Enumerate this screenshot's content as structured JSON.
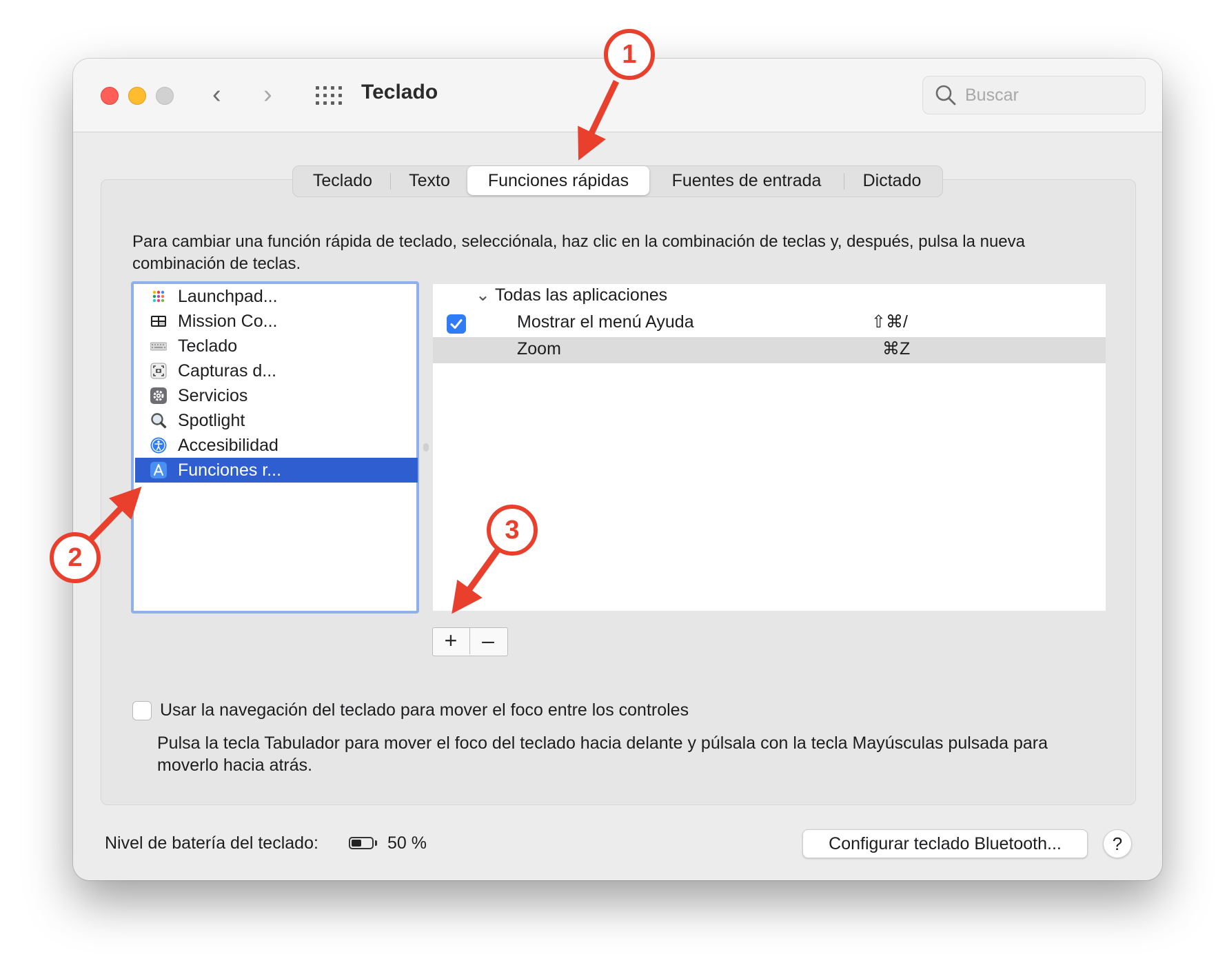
{
  "window": {
    "title": "Teclado"
  },
  "toolbar": {
    "back_glyph": "‹",
    "forward_glyph": "›",
    "search_placeholder": "Buscar"
  },
  "tabs": [
    {
      "label": "Teclado",
      "selected": false
    },
    {
      "label": "Texto",
      "selected": false
    },
    {
      "label": "Funciones rápidas",
      "selected": true
    },
    {
      "label": "Fuentes de entrada",
      "selected": false
    },
    {
      "label": "Dictado",
      "selected": false
    }
  ],
  "description": "Para cambiar una función rápida de teclado, selecciónala, haz clic en la combinación de teclas y, después, pulsa la nueva combinación de teclas.",
  "categories": [
    {
      "label": "Launchpad...",
      "icon": "launchpad-icon"
    },
    {
      "label": "Mission Co...",
      "icon": "mission-control-icon"
    },
    {
      "label": "Teclado",
      "icon": "keyboard-icon"
    },
    {
      "label": "Capturas d...",
      "icon": "screenshot-icon"
    },
    {
      "label": "Servicios",
      "icon": "gear-icon"
    },
    {
      "label": "Spotlight",
      "icon": "magnifier-icon"
    },
    {
      "label": "Accesibilidad",
      "icon": "accessibility-icon"
    },
    {
      "label": "Funciones r...",
      "icon": "app-shortcuts-icon",
      "selected": true
    }
  ],
  "shortcuts": {
    "group_label": "Todas las aplicaciones",
    "group_chevron": "⌄",
    "items": [
      {
        "label": "Mostrar el menú Ayuda",
        "keys": "⇧⌘/",
        "checked": true
      },
      {
        "label": "Zoom",
        "keys": "⌘Z",
        "checked": false,
        "selected": true
      }
    ]
  },
  "list_buttons": {
    "add": "+",
    "remove": "–"
  },
  "keyboard_nav": {
    "label": "Usar la navegación del teclado para mover el foco entre los controles",
    "checked": false,
    "help": "Pulsa la tecla Tabulador para mover el foco del teclado hacia delante y púlsala con la tecla Mayúsculas pulsada para moverlo hacia atrás."
  },
  "footer": {
    "battery_label": "Nivel de batería del teclado:",
    "battery_value": "50 %",
    "battery_level": 0.5,
    "bluetooth_button": "Configurar teclado Bluetooth...",
    "help_button": "?"
  },
  "annotations": [
    "1",
    "2",
    "3"
  ],
  "colors": {
    "accent": "#2f5ed1",
    "checkbox": "#2f7cf6",
    "annotation": "#e8402d",
    "close": "#ff5f57",
    "minimize": "#febc2e",
    "zoom_inactive": "#d1d1d1"
  }
}
